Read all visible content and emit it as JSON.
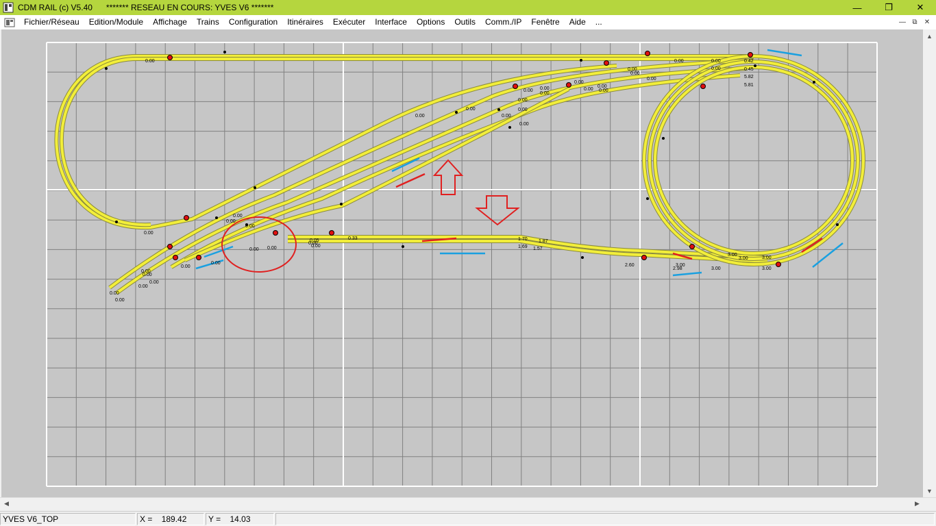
{
  "window": {
    "title": "CDM RAIL (c) V5.40      ******* RESEAU EN COURS: YVES V6 *******",
    "minimize": "—",
    "maximize": "❐",
    "close": "✕"
  },
  "menu": {
    "items": [
      "Fichier/Réseau",
      "Edition/Module",
      "Affichage",
      "Trains",
      "Configuration",
      "Itinéraires",
      "Exécuter",
      "Interface",
      "Options",
      "Outils",
      "Comm./IP",
      "Fenêtre",
      "Aide",
      "..."
    ],
    "mdi_minimize": "—",
    "mdi_restore": "⧉",
    "mdi_close": "✕"
  },
  "layout": {
    "grid_color": "#808080",
    "major_line_color": "#ffffff",
    "track_color": "#f2ee3a",
    "track_edge": "#8a8a3c",
    "speed_labels": [
      "0.00",
      "0.00",
      "0.00",
      "0.00",
      "0.00",
      "0.00",
      "0.00",
      "0.00",
      "0.05",
      "0.00",
      "0.33",
      "0.00",
      "0.00",
      "0.00",
      "0.00",
      "0.00",
      "0.00",
      "0.00",
      "0.00",
      "0.00",
      "0.00",
      "0.00",
      "0.00",
      "0.00",
      "0.00",
      "0.00",
      "0.00",
      "0.00",
      "0.00",
      "0.00",
      "0.42",
      "0.45",
      "5.82",
      "5.81",
      "1.70",
      "1.87",
      "1.69",
      "1.57",
      "2.60",
      "3.00",
      "2.98",
      "3.00",
      "3.00",
      "3.00",
      "3.00",
      "3.00",
      "0.00",
      "0.00",
      "0.00",
      "0.00",
      "0.00",
      "0.00",
      "0.00",
      "0.00"
    ]
  },
  "status": {
    "module": "YVES V6_TOP",
    "x_label": "X =",
    "x_value": "189.42",
    "y_label": "Y =",
    "y_value": "14.03"
  }
}
